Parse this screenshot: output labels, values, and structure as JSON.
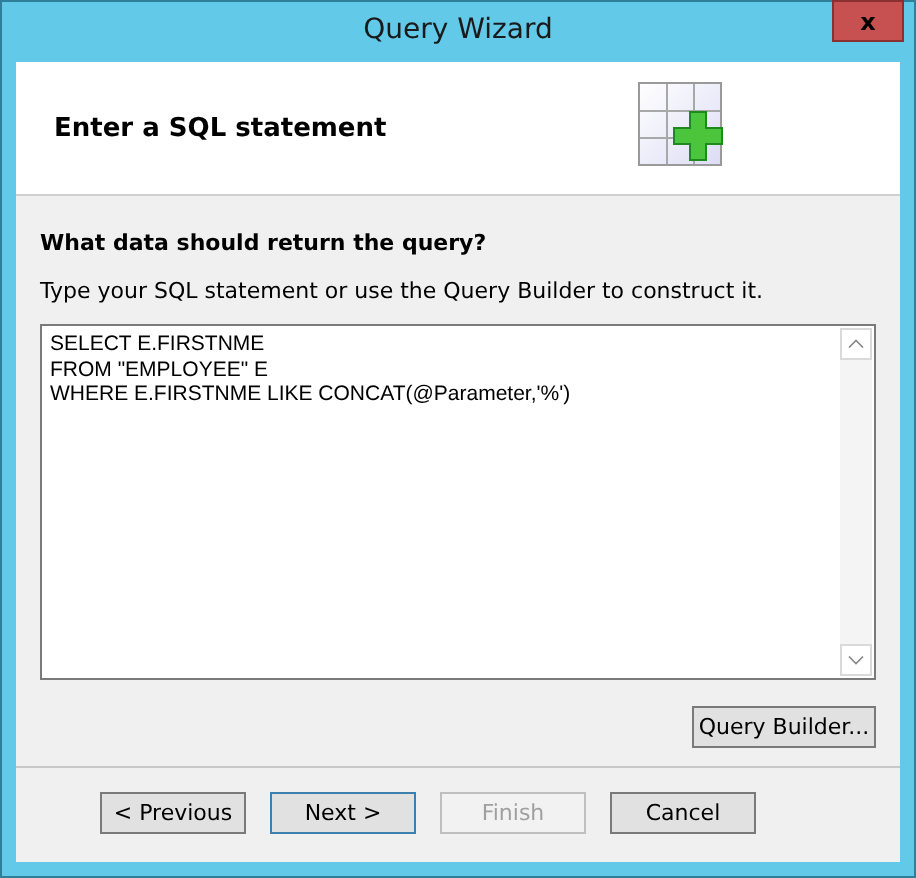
{
  "window": {
    "title": "Query Wizard",
    "close": "x"
  },
  "header": {
    "title": "Enter a SQL statement"
  },
  "question": "What data should return the query?",
  "instruction": "Type your SQL statement or use the Query Builder to construct it.",
  "sql": {
    "lines": [
      "SELECT E.FIRSTNME",
      "FROM \"EMPLOYEE\" E",
      "WHERE E.FIRSTNME LIKE CONCAT(@Parameter,'%')"
    ]
  },
  "query_builder": "Query Builder...",
  "buttons": [
    {
      "label": "< Previous",
      "disabled": false,
      "default": false
    },
    {
      "label": "Next >",
      "disabled": false,
      "default": true
    },
    {
      "label": "Finish",
      "disabled": true,
      "default": false
    },
    {
      "label": "Cancel",
      "disabled": false,
      "default": false
    }
  ]
}
